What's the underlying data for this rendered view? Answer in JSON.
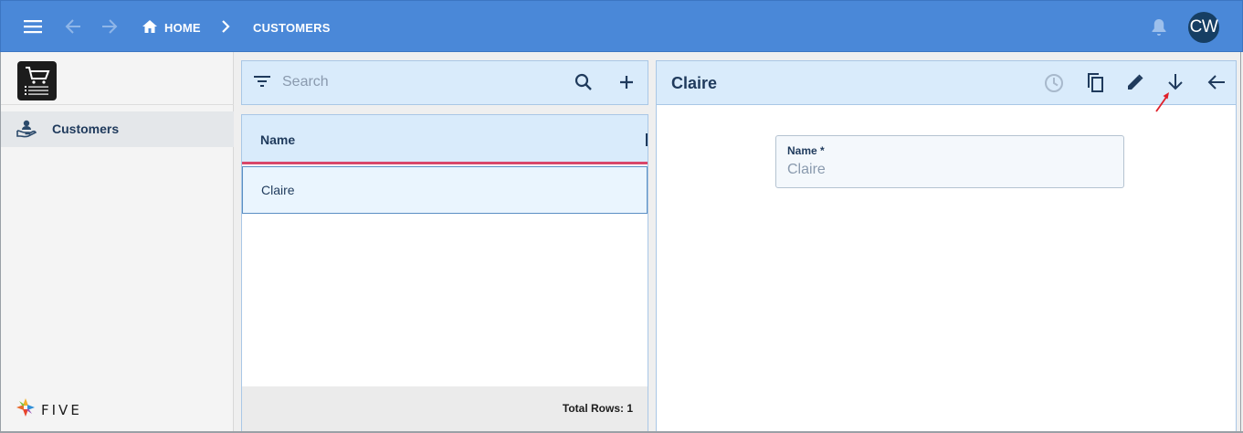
{
  "topbar": {
    "breadcrumb": {
      "home": "HOME",
      "current": "CUSTOMERS"
    },
    "avatar_initials": "CW",
    "icons": [
      "menu-icon",
      "back-arrow-icon",
      "forward-arrow-icon",
      "home-icon",
      "chevron-right-icon",
      "bell-icon"
    ]
  },
  "sidebar": {
    "app_logo_icon": "shopping-cart-icon",
    "items": [
      {
        "label": "Customers",
        "icon": "customer-icon",
        "selected": true
      }
    ],
    "brand_text": "FIVE"
  },
  "search": {
    "placeholder": "Search",
    "icons": [
      "filter-icon",
      "search-icon",
      "add-icon"
    ]
  },
  "list": {
    "columns": [
      "Name"
    ],
    "rows": [
      {
        "name": "Claire"
      }
    ],
    "footer": "Total Rows: 1"
  },
  "detail": {
    "title": "Claire",
    "toolbar_icons": [
      "history-icon",
      "copy-icon",
      "edit-icon",
      "down-arrow-icon",
      "back-arrow-icon"
    ],
    "fields": [
      {
        "label": "Name *",
        "value": "Claire"
      }
    ]
  },
  "colors": {
    "topbar": "#4a88d8",
    "panel_header": "#d9ebfb",
    "text": "#1f3a5c",
    "selected_row_border": "#d9476a",
    "annotation_arrow": "#e0202a"
  }
}
